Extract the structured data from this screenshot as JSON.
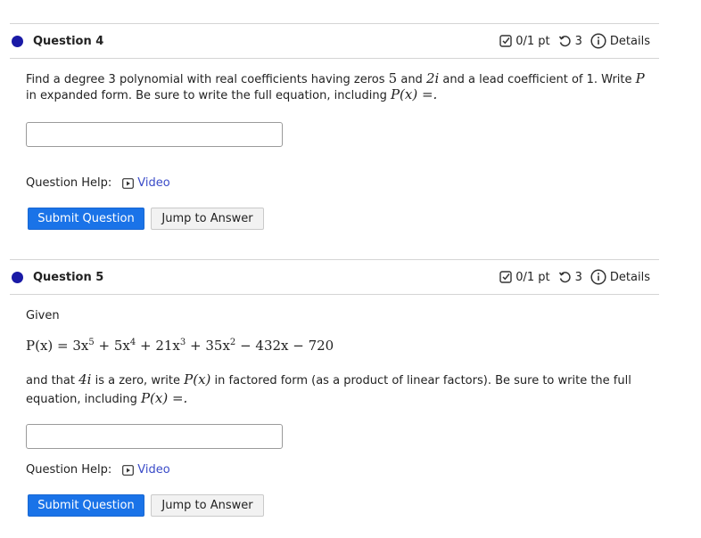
{
  "questions": [
    {
      "title": "Question 4",
      "score": "0/1 pt",
      "attempts": "3",
      "details": "Details",
      "text_a": "Find a degree 3 polynomial with real coefficients having zeros ",
      "zero1": "5",
      "text_b": " and ",
      "zero2": "2i",
      "text_c": " and a lead coefficient of 1. Write ",
      "var_p": "P",
      "text_d": "in expanded form. Be sure to write the full equation, including ",
      "px_eq": "P(x) =.",
      "answer_value": "",
      "help_label": "Question Help:",
      "video_label": "Video",
      "submit_label": "Submit Question",
      "jump_label": "Jump to Answer"
    },
    {
      "title": "Question 5",
      "score": "0/1 pt",
      "attempts": "3",
      "details": "Details",
      "given": "Given",
      "text_a": "and that ",
      "zero": "4i",
      "text_b": " is a zero, write ",
      "px": "P(x)",
      "text_c": " in factored form (as a product of linear factors). Be sure to write the full",
      "text_d": "equation, including ",
      "px_eq": "P(x) =.",
      "answer_value": "",
      "help_label": "Question Help:",
      "video_label": "Video",
      "submit_label": "Submit Question",
      "jump_label": "Jump to Answer"
    }
  ],
  "formula": {
    "lhs": "P(x) = 3x",
    "e1": "5",
    "t2": " + 5x",
    "e2": "4",
    "t3": " + 21x",
    "e3": "3",
    "t4": " + 35x",
    "e4": "2",
    "t5": " − 432x − 720"
  },
  "colors": {
    "accent": "#1a73e8",
    "dot": "#1a1aa6",
    "link": "#3a4bc8"
  },
  "icons": [
    "checkbox-icon",
    "retry-icon",
    "info-icon",
    "video-icon"
  ]
}
